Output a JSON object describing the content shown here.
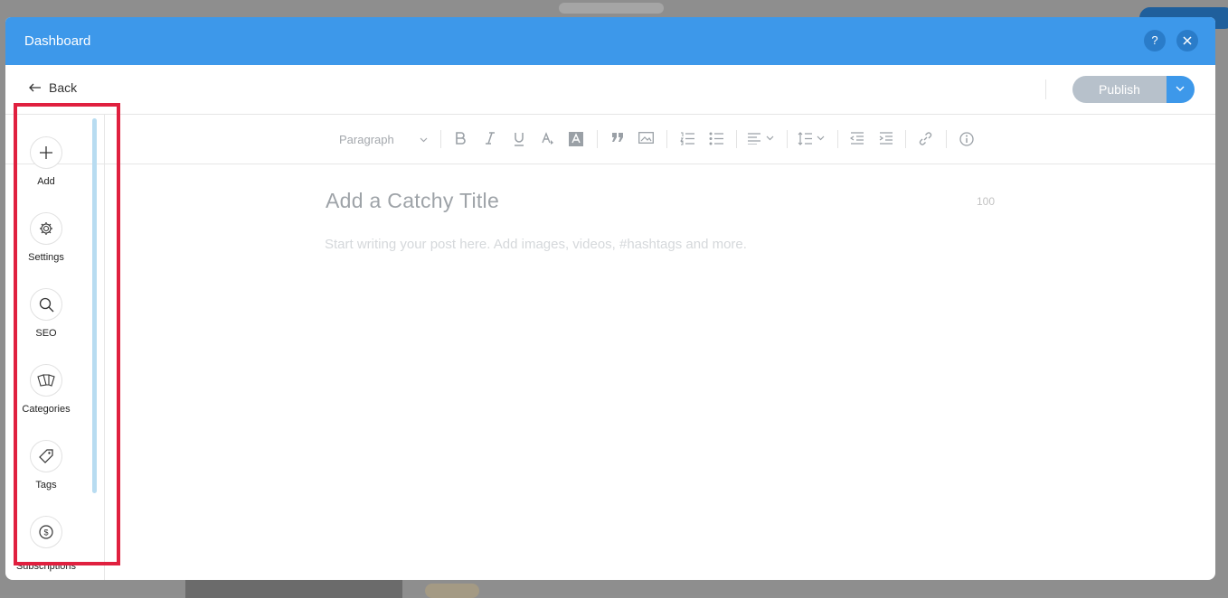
{
  "modal": {
    "title": "Dashboard"
  },
  "header_buttons": {
    "help": "?",
    "close": "×"
  },
  "topbar": {
    "back_label": "Back",
    "publish_label": "Publish"
  },
  "toolbar": {
    "paragraph": "Paragraph",
    "icons": [
      "bold-icon",
      "italic-icon",
      "underline-icon",
      "text-color-icon",
      "highlight-icon",
      "quote-icon",
      "image-icon",
      "numbered-list-icon",
      "bullet-list-icon",
      "align-icon",
      "line-spacing-icon",
      "indent-decrease-icon",
      "indent-increase-icon",
      "link-icon",
      "info-icon"
    ]
  },
  "editor": {
    "title_placeholder": "Add a Catchy Title",
    "title_counter": "100",
    "body_placeholder": "Start writing your post here. Add images, videos, #hashtags and more."
  },
  "sidebar": {
    "items": [
      {
        "label": "Add",
        "icon": "plus-icon"
      },
      {
        "label": "Settings",
        "icon": "gear-icon"
      },
      {
        "label": "SEO",
        "icon": "search-icon"
      },
      {
        "label": "Categories",
        "icon": "categories-icon"
      },
      {
        "label": "Tags",
        "icon": "tag-icon"
      },
      {
        "label": "Subscriptions",
        "icon": "dollar-icon"
      }
    ]
  },
  "colors": {
    "accent": "#3d98ea",
    "highlight": "#e0203f",
    "publish_disabled": "#b7c1cb"
  }
}
